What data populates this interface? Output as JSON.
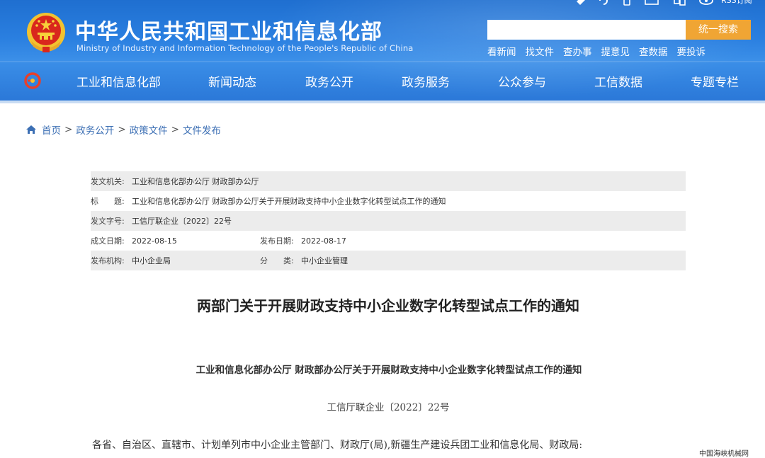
{
  "header": {
    "title_cn": "中华人民共和国工业和信息化部",
    "title_en": "Ministry of Industry and Information Technology of the People's Republic of China",
    "top_icons": [
      "weibo-icon",
      "wechat-icon",
      "mobile-icon",
      "mail-icon",
      "accessibility-icon",
      "rss-icon"
    ],
    "rss_label": "RSS订阅",
    "search": {
      "value": "",
      "button_label": "统一搜索"
    },
    "quick_links": [
      "看新闻",
      "找文件",
      "查办事",
      "提意见",
      "查数据",
      "要投诉"
    ],
    "nav": [
      "工业和信息化部",
      "新闻动态",
      "政务公开",
      "政务服务",
      "公众参与",
      "工信数据",
      "专题专栏"
    ]
  },
  "breadcrumb": [
    "首页",
    "政务公开",
    "政策文件",
    "文件发布"
  ],
  "meta": {
    "issuer_label": "发文机关:",
    "issuer": "工业和信息化部办公厅 财政部办公厅",
    "title_label": "标　　题:",
    "title": "工业和信息化部办公厅 财政部办公厅关于开展财政支持中小企业数字化转型试点工作的通知",
    "docno_label": "发文字号:",
    "docno": "工信厅联企业〔2022〕22号",
    "created_label": "成文日期:",
    "created": "2022-08-15",
    "published_label": "发布日期:",
    "published": "2022-08-17",
    "agency_label": "发布机构:",
    "agency": "中小企业局",
    "category_label": "分　　类:",
    "category": "中小企业管理"
  },
  "article": {
    "title": "两部门关于开展财政支持中小企业数字化转型试点工作的通知",
    "heading": "工业和信息化部办公厅 财政部办公厅关于开展财政支持中小企业数字化转型试点工作的通知",
    "doc_number": "工信厅联企业〔2022〕22号",
    "salutation": "各省、自治区、直辖市、计划单列市中小企业主管部门、财政厅(局),新疆生产建设兵团工业和信息化局、财政局:"
  },
  "watermark": "中国海峡机械网",
  "colors": {
    "header_blue": "#2a7fe0",
    "search_button": "#f0a534",
    "link_blue": "#3c6fb4",
    "row_shade": "#ececec"
  }
}
